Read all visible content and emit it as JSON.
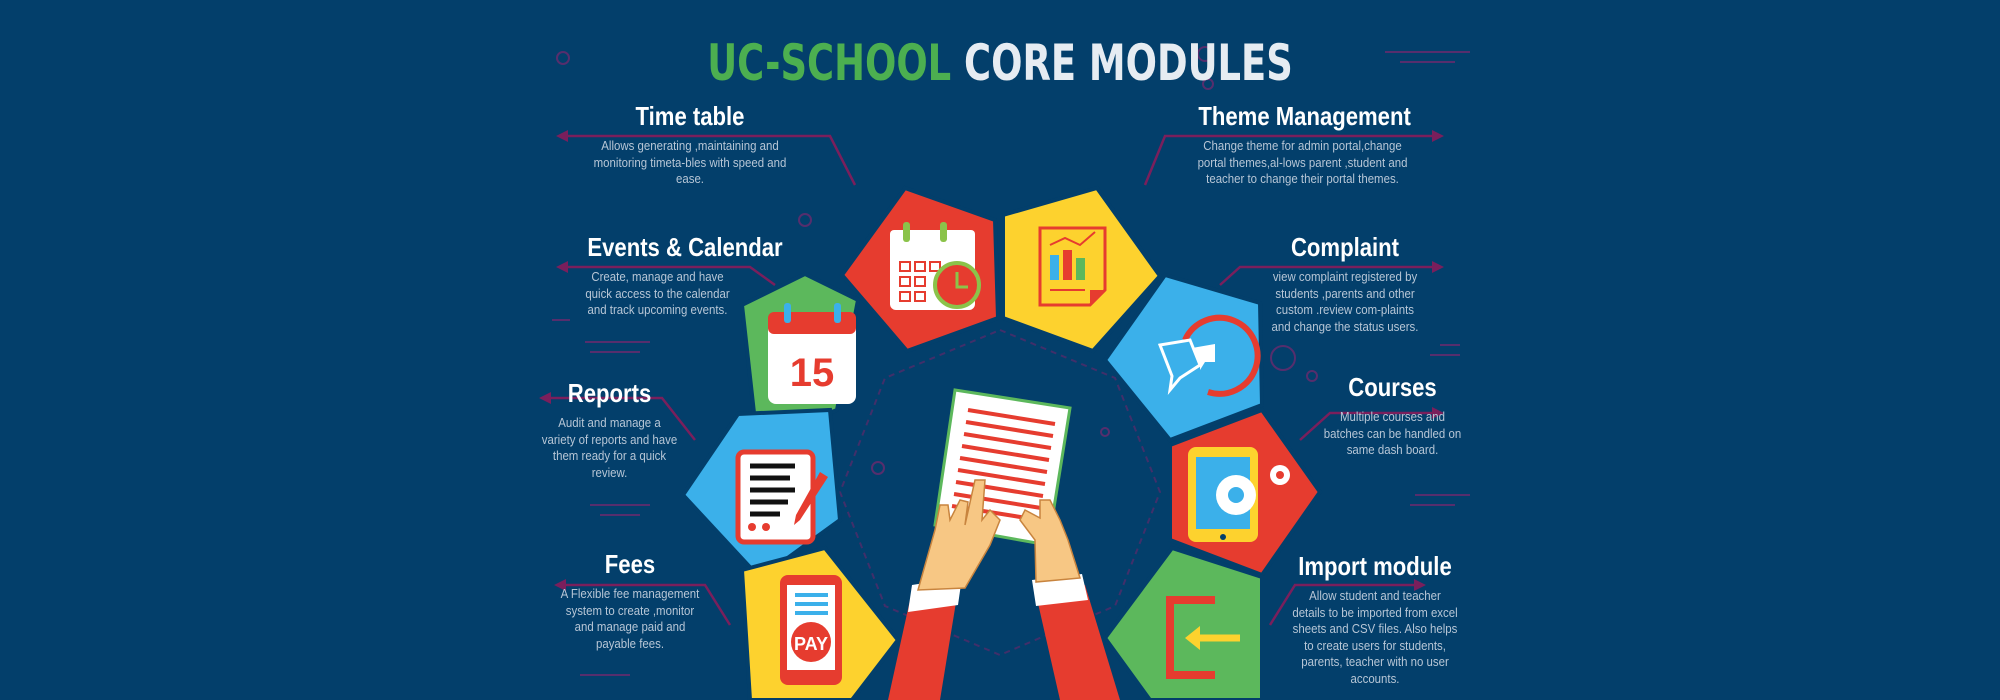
{
  "header": {
    "title_accent": "UC-SCHOOL",
    "title_rest": "CORE MODULES"
  },
  "modules": [
    {
      "id": "timetable",
      "title": "Time table",
      "description": "Allows generating ,maintaining and monitoring timeta-bles with speed and ease."
    },
    {
      "id": "events",
      "title": "Events & Calendar",
      "description": "Create, manage and have quick access to the calendar and track upcoming events."
    },
    {
      "id": "reports",
      "title": "Reports",
      "description": "Audit and manage a variety of reports and have them ready for a quick review."
    },
    {
      "id": "fees",
      "title": "Fees",
      "description": "A Flexible fee management system to create ,monitor and manage paid and payable fees."
    },
    {
      "id": "theme",
      "title": "Theme Management",
      "description": "Change theme for admin portal,change portal themes,al-lows parent ,student and teacher to change their portal themes."
    },
    {
      "id": "complaint",
      "title": "Complaint",
      "description": "view complaint registered by students ,parents and other custom .review com-plaints and change the status users."
    },
    {
      "id": "courses",
      "title": "Courses",
      "description": "Multiple courses and batches can be handled on same dash board."
    },
    {
      "id": "import",
      "title": "Import module",
      "description": "Allow student and teacher details to be imported from excel sheets and CSV files. Also helps to create users for students, parents, teacher with no user accounts."
    }
  ],
  "icons": {
    "calendar_date": "15",
    "pay_label": "PAY"
  },
  "colors": {
    "background": "#033f6b",
    "red": "#e63c2f",
    "yellow": "#fdd22e",
    "green": "#5cb85c",
    "blue": "#3bb0ea",
    "title_accent": "#4caf50",
    "connector": "#7a1f5c"
  }
}
